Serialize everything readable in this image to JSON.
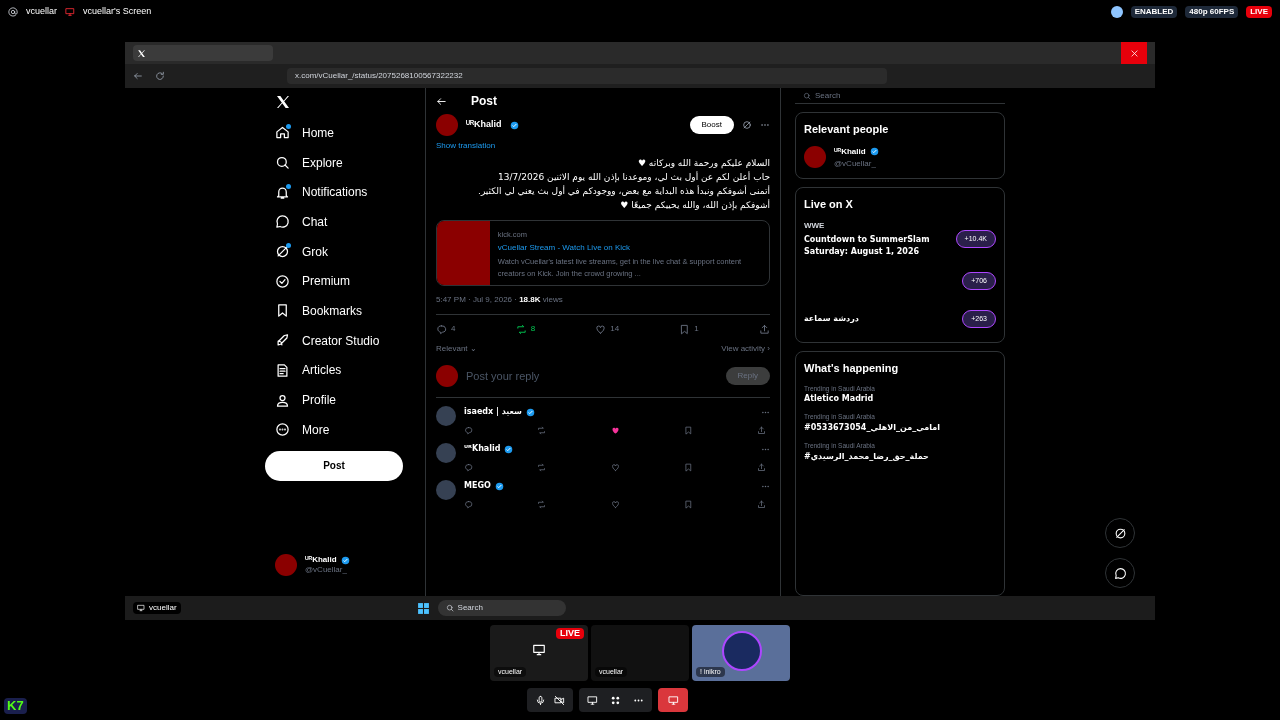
{
  "stream_header": {
    "user": "vcuellar",
    "screen_title": "vcuellar's Screen",
    "badges": [
      {
        "label": "ENABLED",
        "kind": "plain"
      },
      {
        "label": "480p 60FPS",
        "kind": "plain"
      },
      {
        "label": "LIVE",
        "kind": "live"
      }
    ]
  },
  "browser": {
    "address": "x.com/vCuellar_/status/2075268100567322232"
  },
  "nav": {
    "items": [
      {
        "label": "Home",
        "badge": true
      },
      {
        "label": "Explore",
        "badge": false
      },
      {
        "label": "Notifications",
        "badge": true
      },
      {
        "label": "Chat",
        "badge": false
      },
      {
        "label": "Grok",
        "badge": true
      },
      {
        "label": "Premium",
        "badge": false
      },
      {
        "label": "Bookmarks",
        "badge": false
      },
      {
        "label": "Creator Studio",
        "badge": false
      },
      {
        "label": "Articles",
        "badge": false
      },
      {
        "label": "Profile",
        "badge": false
      },
      {
        "label": "More",
        "badge": false
      }
    ],
    "post_button": "Post",
    "account": {
      "name": "ᵁᴿKhalid",
      "handle": "@vCuellar_"
    }
  },
  "post": {
    "header": "Post",
    "author": "ᵁᴿKhalid",
    "boost_button": "Boost",
    "show_translation": "Show translation",
    "text_lines": [
      "السلام عليكم ورحمة الله وبركاته ♥",
      "حاب أعلن لكم عن أول بث لي، وموعدنا بإذن الله يوم الاثنين 13/7/2026",
      "أتمنى أشوفكم ونبدأ هذه البداية مع بعض، ووجودكم في أول بث يعني لي الكثير.",
      "أشوفكم بإذن الله، والله يحييكم جميعًا ♥"
    ],
    "card": {
      "domain": "kick.com",
      "title": "vCuellar Stream - Watch Live on Kick",
      "description": "Watch vCuellar's latest live streams, get in the live chat & support content creators on Kick. Join the crowd growing ..."
    },
    "meta": "5:47 PM · Jul 9, 2026 · ",
    "views": "18.8K",
    "views_label": " views",
    "actions": [
      {
        "kind": "reply",
        "count": "4",
        "on": false
      },
      {
        "kind": "repost",
        "count": "8",
        "on": true
      },
      {
        "kind": "like",
        "count": "14",
        "on": false
      },
      {
        "kind": "bookmark",
        "count": "1",
        "on": false
      },
      {
        "kind": "share",
        "on": false
      }
    ],
    "sort": "Relevant ⌄",
    "view_activity": "View activity ›",
    "reply_placeholder": "Post your reply",
    "reply_button": "Reply"
  },
  "replies": [
    {
      "name": "isaedx | سعيد",
      "liked": true
    },
    {
      "name": "ᵁᴿKhalid",
      "liked": false
    },
    {
      "name": "MEGO",
      "liked": false
    }
  ],
  "sidebar": {
    "search_placeholder": "Search",
    "relevant_title": "Relevant people",
    "person": {
      "name": "ᵁᴿKhalid",
      "handle": "@vCuellar_"
    },
    "live_title": "Live on X",
    "live": [
      {
        "host": "WWE",
        "title": "Countdown to SummerSlam Saturday: August 1, 2026",
        "count": "+10.4K"
      },
      {
        "count": "+706"
      },
      {
        "title": "دردشة سماعة",
        "count": "+263"
      }
    ],
    "happening_title": "What's happening",
    "trends": [
      {
        "context": "Trending in Saudi Arabia",
        "topic": "Atletico Madrid"
      },
      {
        "context": "Trending in Saudi Arabia",
        "topic": "#امامي_من_الاهلي_0533673054"
      },
      {
        "context": "Trending in Saudi Arabia",
        "topic": "#حملة_حق_رضا_محمد_الرسيدي"
      }
    ]
  },
  "taskbar": {
    "user": "vcuellar",
    "search_placeholder": "Search"
  },
  "call": {
    "tiles": [
      {
        "name": "vcuellar",
        "kind": "screen",
        "live": "LIVE"
      },
      {
        "name": "vcuellar",
        "kind": "camera"
      },
      {
        "name": "! inikro",
        "kind": "avatar"
      }
    ],
    "logo": "K7"
  }
}
